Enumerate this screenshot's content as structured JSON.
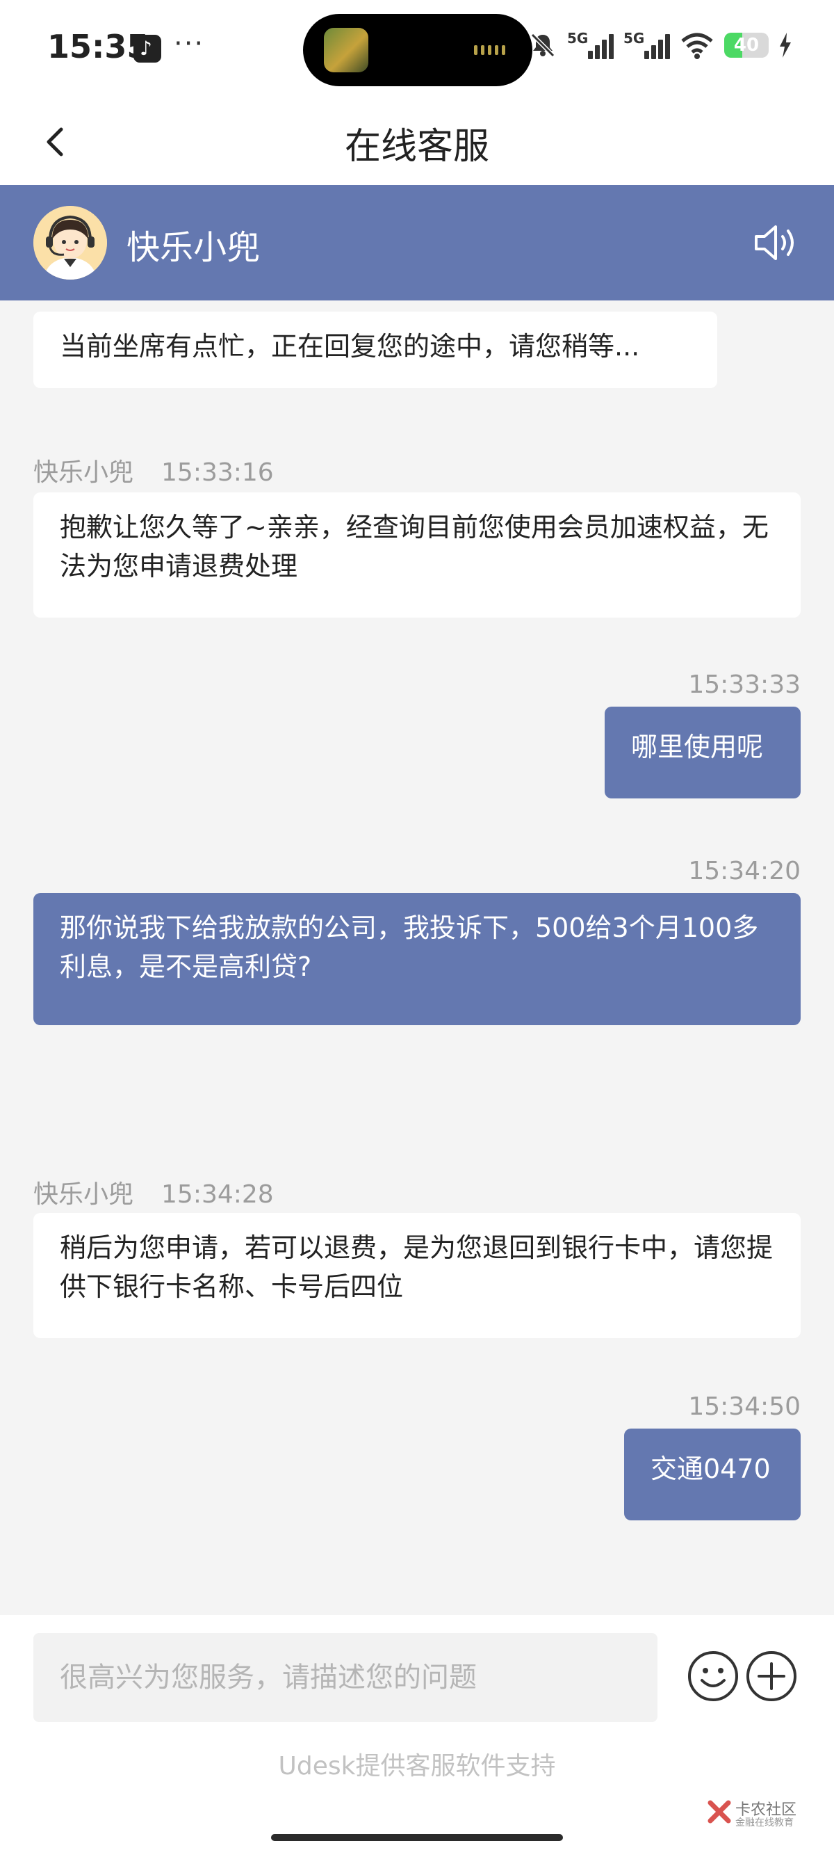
{
  "status_bar": {
    "time": "15:35",
    "more": "···",
    "battery_level": "40",
    "network_label": "5G"
  },
  "nav": {
    "title": "在线客服"
  },
  "agent": {
    "name": "快乐小兜"
  },
  "messages": [
    {
      "side": "agent",
      "text": "当前坐席有点忙，正在回复您的途中，请您稍等..."
    },
    {
      "side": "agent",
      "sender": "快乐小兜",
      "time": "15:33:16",
      "text": "抱歉让您久等了~亲亲，经查询目前您使用会员加速权益，无法为您申请退费处理"
    },
    {
      "side": "user",
      "time": "15:33:33",
      "text": "哪里使用呢"
    },
    {
      "side": "user",
      "time": "15:34:20",
      "text": "那你说我下给我放款的公司，我投诉下，500给3个月100多利息，是不是高利贷?"
    },
    {
      "side": "agent",
      "sender": "快乐小兜",
      "time": "15:34:28",
      "text": "稍后为您申请，若可以退费，是为您退回到银行卡中，请您提供下银行卡名称、卡号后四位"
    },
    {
      "side": "user",
      "time": "15:34:50",
      "text": "交通0470"
    }
  ],
  "composer": {
    "placeholder": "很高兴为您服务，请描述您的问题"
  },
  "footer": {
    "powered_by": "Udesk提供客服软件支持"
  },
  "watermark": {
    "title": "卡农社区",
    "subtitle": "金融在线教育"
  },
  "colors": {
    "brand": "#6478b0",
    "chat_bg": "#f4f4f4",
    "meta": "#9c9c9c"
  }
}
